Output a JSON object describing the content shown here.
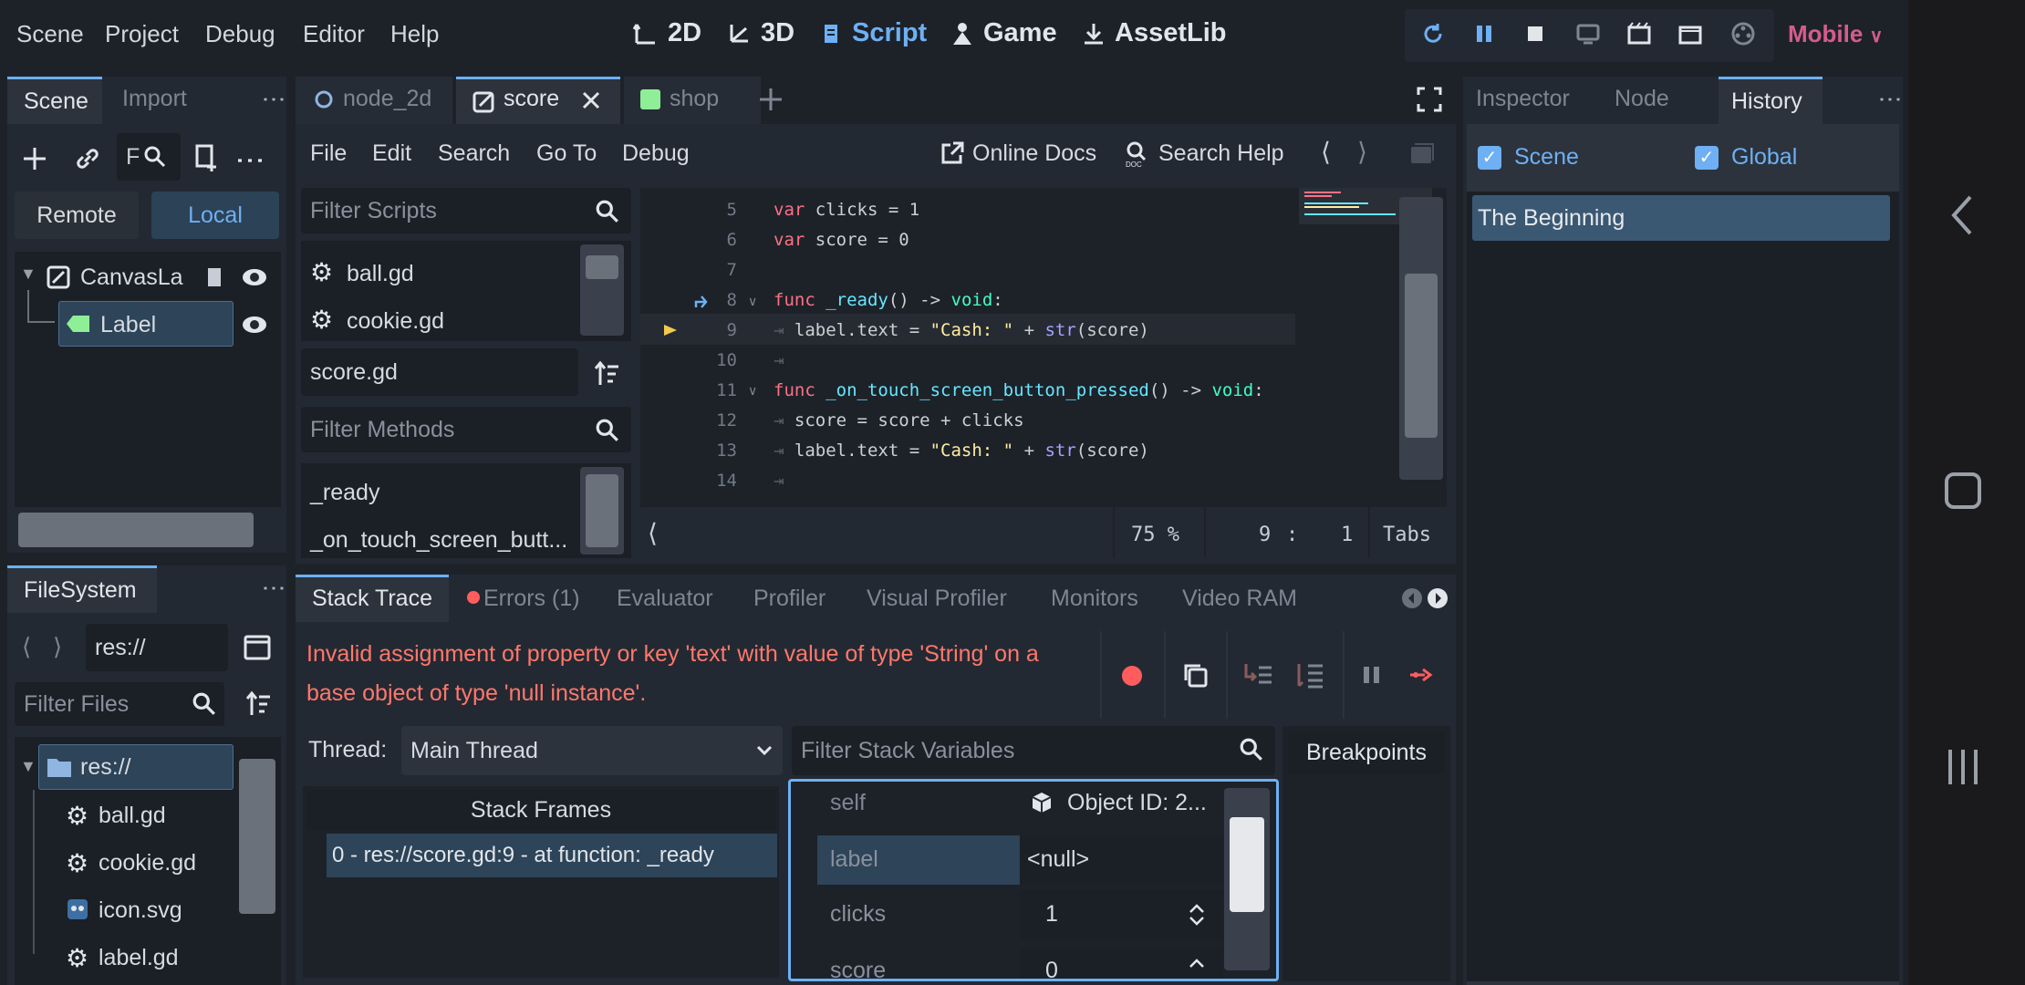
{
  "menu": [
    "Scene",
    "Project",
    "Debug",
    "Editor",
    "Help"
  ],
  "workspaces": {
    "w2d": "2D",
    "w3d": "3D",
    "script": "Script",
    "game": "Game",
    "assetlib": "AssetLib"
  },
  "renderer": "Mobile",
  "scene_dock": {
    "tabs": [
      "Scene",
      "Import"
    ],
    "filter_placeholder": "F",
    "remote": "Remote",
    "local": "Local",
    "tree": {
      "root": "CanvasLa",
      "child": "Label"
    }
  },
  "filesystem": {
    "tab": "FileSystem",
    "path": "res://",
    "filter_placeholder": "Filter Files",
    "items": [
      "res://",
      "ball.gd",
      "cookie.gd",
      "icon.svg",
      "label.gd"
    ]
  },
  "editor_tabs": [
    "node_2d",
    "score",
    "shop"
  ],
  "script_menu": [
    "File",
    "Edit",
    "Search",
    "Go To",
    "Debug"
  ],
  "script_links": {
    "docs": "Online Docs",
    "help": "Search Help"
  },
  "scripts_panel": {
    "filter_placeholder": "Filter Scripts",
    "scripts": [
      "ball.gd",
      "cookie.gd"
    ],
    "current": "score.gd",
    "methods_placeholder": "Filter Methods",
    "methods": [
      "_ready",
      "_on_touch_screen_butt..."
    ]
  },
  "code": {
    "numbers": [
      "5",
      "6",
      "7",
      "8",
      "9",
      "10",
      "11",
      "12",
      "13",
      "14"
    ]
  },
  "status": {
    "zoom": "75 %",
    "line": "9",
    "sep": ":",
    "col": "1",
    "indent": "Tabs"
  },
  "debugger": {
    "tabs": [
      "Stack Trace",
      "Errors (1)",
      "Evaluator",
      "Profiler",
      "Visual Profiler",
      "Monitors",
      "Video RAM"
    ],
    "error": "Invalid assignment of property or key 'text' with value of type 'String' on a base object of type 'null instance'.",
    "thread_label": "Thread:",
    "thread": "Main Thread",
    "frames_header": "Stack Frames",
    "frame": "0 - res://score.gd:9 - at function: _ready",
    "vars_placeholder": "Filter Stack Variables",
    "vars": [
      {
        "name": "self",
        "value": "Object ID: 2..."
      },
      {
        "name": "label",
        "value": "<null>"
      },
      {
        "name": "clicks",
        "value": "1"
      },
      {
        "name": "score",
        "value": "0"
      }
    ],
    "breakpoints": "Breakpoints"
  },
  "inspector": {
    "tabs": [
      "Inspector",
      "Node",
      "History"
    ],
    "scene": "Scene",
    "global": "Global",
    "history_items": [
      "The Beginning"
    ]
  },
  "colors": {
    "accent": "#6eb0f3",
    "error": "#ff786b",
    "bg": "#1d2229",
    "panel": "#232933"
  }
}
